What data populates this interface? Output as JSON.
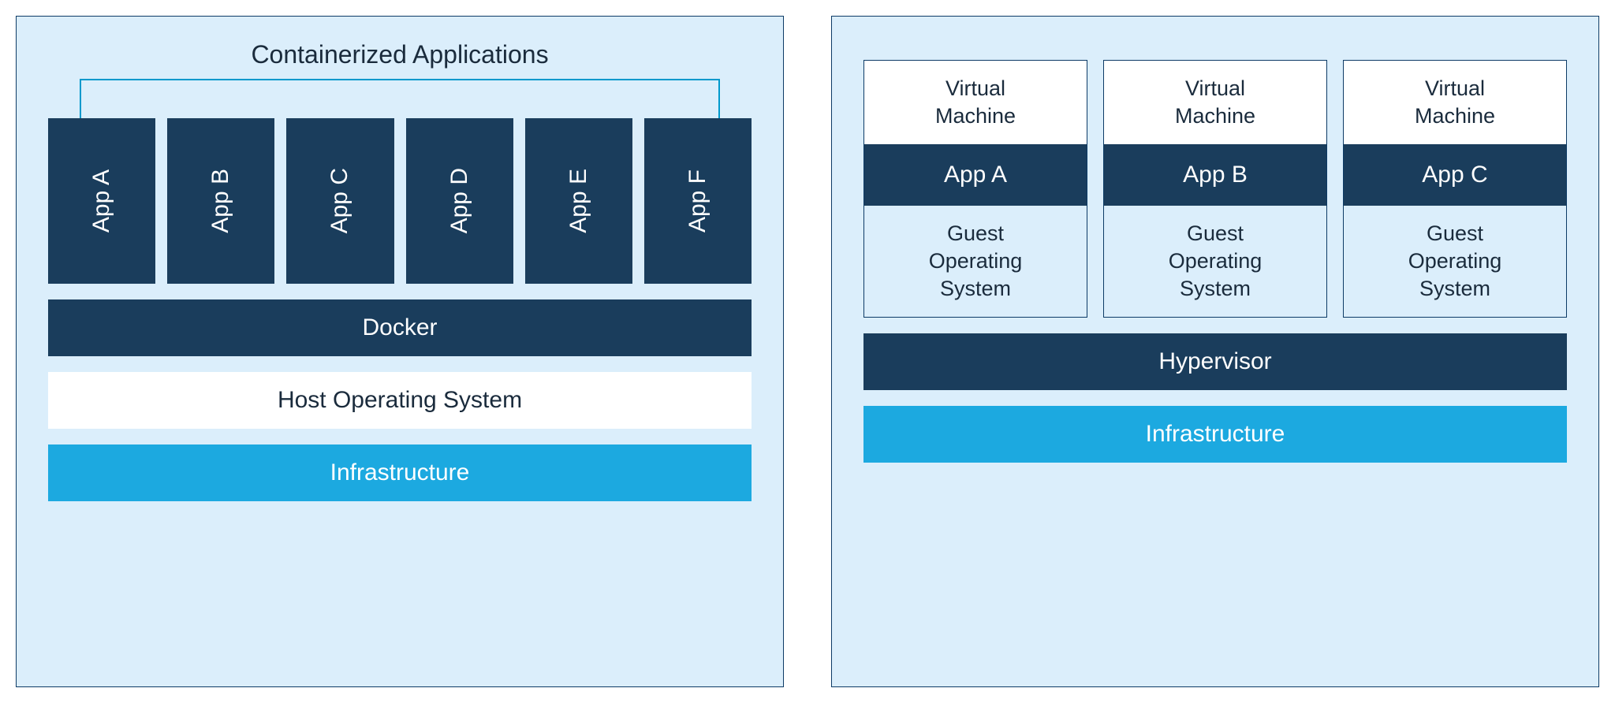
{
  "left": {
    "title": "Containerized Applications",
    "apps": [
      "App A",
      "App B",
      "App C",
      "App D",
      "App E",
      "App F"
    ],
    "docker": "Docker",
    "host_os": "Host Operating System",
    "infrastructure": "Infrastructure"
  },
  "right": {
    "vms": [
      {
        "title": "Virtual\nMachine",
        "app": "App A",
        "os": "Guest\nOperating\nSystem"
      },
      {
        "title": "Virtual\nMachine",
        "app": "App B",
        "os": "Guest\nOperating\nSystem"
      },
      {
        "title": "Virtual\nMachine",
        "app": "App C",
        "os": "Guest\nOperating\nSystem"
      }
    ],
    "hypervisor": "Hypervisor",
    "infrastructure": "Infrastructure"
  }
}
